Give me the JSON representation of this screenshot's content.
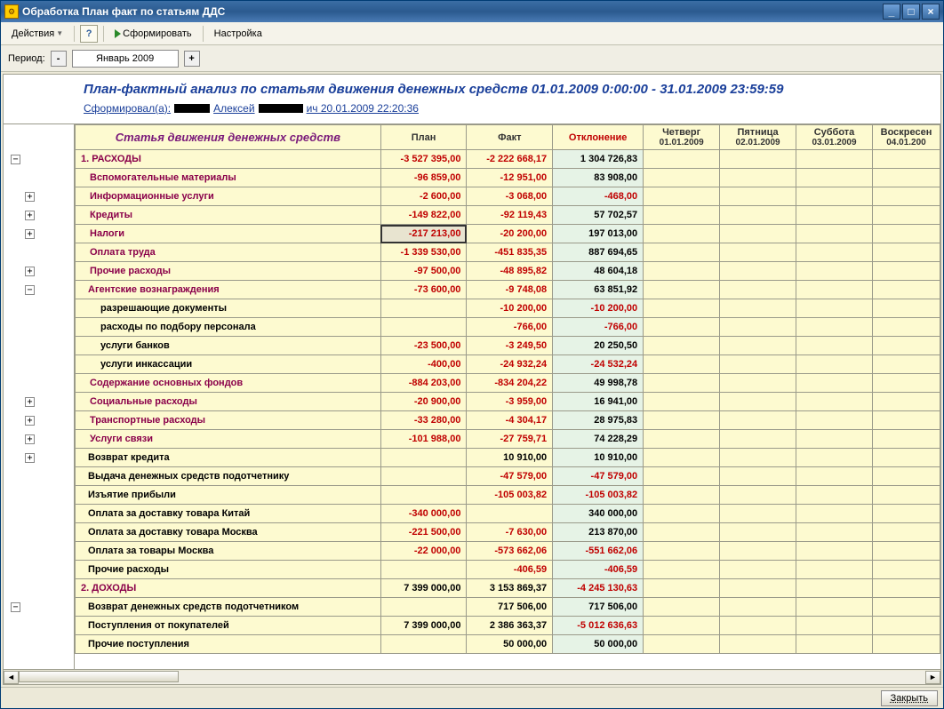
{
  "window": {
    "title": "Обработка  План факт по статьям ДДС"
  },
  "menubar": {
    "actions": "Действия",
    "help": "?",
    "form": "Сформировать",
    "settings": "Настройка"
  },
  "periodbar": {
    "label": "Период:",
    "value": "Январь 2009"
  },
  "report": {
    "title": "План-фактный анализ по статьям движения денежных средств  01.01.2009 0:00:00  -  31.01.2009 23:59:59",
    "formed_prefix": "Сформировал(а): ",
    "formed_name_mid": " Алексей ",
    "formed_name_suffix": "ич 20.01.2009 22:20:36"
  },
  "columns": {
    "article": "Статья движения денежных средств",
    "plan": "План",
    "fact": "Факт",
    "dev": "Отклонение",
    "d1_top": "Четверг",
    "d1_bot": "01.01.2009",
    "d2_top": "Пятница",
    "d2_bot": "02.01.2009",
    "d3_top": "Суббота",
    "d3_bot": "03.01.2009",
    "d4_top": "Воскресен",
    "d4_bot": "04.01.200"
  },
  "rows": [
    {
      "id": "r0",
      "cls": "section",
      "pad": 0,
      "article": "1. РАСХОДЫ",
      "plan": "-3 527 395,00",
      "fact": "-2 222 668,17",
      "dev": "1 304 726,83",
      "pneg": true,
      "fneg": true,
      "dneg": false
    },
    {
      "id": "r1",
      "cls": "cat",
      "pad": 1,
      "article": "Вспомогательные материалы",
      "plan": "-96 859,00",
      "fact": "-12 951,00",
      "dev": "83 908,00",
      "pneg": true,
      "fneg": true,
      "dneg": false
    },
    {
      "id": "r2",
      "cls": "cat",
      "pad": 1,
      "article": "Информационные услуги",
      "plan": "-2 600,00",
      "fact": "-3 068,00",
      "dev": "-468,00",
      "pneg": true,
      "fneg": true,
      "dneg": true
    },
    {
      "id": "r3",
      "cls": "cat",
      "pad": 1,
      "article": "Кредиты",
      "plan": "-149 822,00",
      "fact": "-92 119,43",
      "dev": "57 702,57",
      "pneg": true,
      "fneg": true,
      "dneg": false
    },
    {
      "id": "r4",
      "cls": "cat",
      "pad": 1,
      "article": "Налоги",
      "plan": "-217 213,00",
      "fact": "-20 200,00",
      "dev": "197 013,00",
      "pneg": true,
      "fneg": true,
      "dneg": false,
      "sel": true
    },
    {
      "id": "r5",
      "cls": "cat",
      "pad": 1,
      "article": "Оплата труда",
      "plan": "-1 339 530,00",
      "fact": "-451 835,35",
      "dev": "887 694,65",
      "pneg": true,
      "fneg": true,
      "dneg": false
    },
    {
      "id": "r6",
      "cls": "cat",
      "pad": 1,
      "article": "Прочие расходы",
      "plan": "-97 500,00",
      "fact": "-48 895,82",
      "dev": "48 604,18",
      "pneg": true,
      "fneg": true,
      "dneg": false
    },
    {
      "id": "r7",
      "cls": "subcat",
      "pad": 2,
      "article": "Агентские вознаграждения",
      "plan": "-73 600,00",
      "fact": "-9 748,08",
      "dev": "63 851,92",
      "pneg": true,
      "fneg": true,
      "dneg": false
    },
    {
      "id": "r8",
      "cls": "leaf",
      "pad": 2,
      "article": "разрешающие документы",
      "plan": "",
      "fact": "-10 200,00",
      "dev": "-10 200,00",
      "pneg": false,
      "fneg": true,
      "dneg": true
    },
    {
      "id": "r9",
      "cls": "leaf",
      "pad": 2,
      "article": "расходы по подбору персонала",
      "plan": "",
      "fact": "-766,00",
      "dev": "-766,00",
      "pneg": false,
      "fneg": true,
      "dneg": true
    },
    {
      "id": "r10",
      "cls": "leaf",
      "pad": 2,
      "article": "услуги банков",
      "plan": "-23 500,00",
      "fact": "-3 249,50",
      "dev": "20 250,50",
      "pneg": true,
      "fneg": true,
      "dneg": false
    },
    {
      "id": "r11",
      "cls": "leaf",
      "pad": 2,
      "article": "услуги инкассации",
      "plan": "-400,00",
      "fact": "-24 932,24",
      "dev": "-24 532,24",
      "pneg": true,
      "fneg": true,
      "dneg": true
    },
    {
      "id": "r12",
      "cls": "cat",
      "pad": 1,
      "article": "Содержание основных фондов",
      "plan": "-884 203,00",
      "fact": "-834 204,22",
      "dev": "49 998,78",
      "pneg": true,
      "fneg": true,
      "dneg": false
    },
    {
      "id": "r13",
      "cls": "cat",
      "pad": 1,
      "article": "Социальные расходы",
      "plan": "-20 900,00",
      "fact": "-3 959,00",
      "dev": "16 941,00",
      "pneg": true,
      "fneg": true,
      "dneg": false
    },
    {
      "id": "r14",
      "cls": "cat",
      "pad": 1,
      "article": "Транспортные расходы",
      "plan": "-33 280,00",
      "fact": "-4 304,17",
      "dev": "28 975,83",
      "pneg": true,
      "fneg": true,
      "dneg": false
    },
    {
      "id": "r15",
      "cls": "cat",
      "pad": 1,
      "article": "Услуги связи",
      "plan": "-101 988,00",
      "fact": "-27 759,71",
      "dev": "74 228,29",
      "pneg": true,
      "fneg": true,
      "dneg": false
    },
    {
      "id": "r16",
      "cls": "plain",
      "pad": 1,
      "article": "Возврат кредита",
      "plan": "",
      "fact": "10 910,00",
      "dev": "10 910,00",
      "pneg": false,
      "fneg": false,
      "dneg": false
    },
    {
      "id": "r17",
      "cls": "plain",
      "pad": 1,
      "article": "Выдача денежных средств подотчетнику",
      "plan": "",
      "fact": "-47 579,00",
      "dev": "-47 579,00",
      "pneg": false,
      "fneg": true,
      "dneg": true
    },
    {
      "id": "r18",
      "cls": "plain",
      "pad": 1,
      "article": "Изъятие прибыли",
      "plan": "",
      "fact": "-105 003,82",
      "dev": "-105 003,82",
      "pneg": false,
      "fneg": true,
      "dneg": true
    },
    {
      "id": "r19",
      "cls": "plain",
      "pad": 1,
      "article": "Оплата за доставку товара Китай",
      "plan": "-340 000,00",
      "fact": "",
      "dev": "340 000,00",
      "pneg": true,
      "fneg": false,
      "dneg": false
    },
    {
      "id": "r20",
      "cls": "plain",
      "pad": 1,
      "article": "Оплата за доставку товара Москва",
      "plan": "-221 500,00",
      "fact": "-7 630,00",
      "dev": "213 870,00",
      "pneg": true,
      "fneg": true,
      "dneg": false
    },
    {
      "id": "r21",
      "cls": "plain",
      "pad": 1,
      "article": "Оплата за товары Москва",
      "plan": "-22 000,00",
      "fact": "-573 662,06",
      "dev": "-551 662,06",
      "pneg": true,
      "fneg": true,
      "dneg": true
    },
    {
      "id": "r22",
      "cls": "plain",
      "pad": 1,
      "article": "Прочие расходы",
      "plan": "",
      "fact": "-406,59",
      "dev": "-406,59",
      "pneg": false,
      "fneg": true,
      "dneg": true
    },
    {
      "id": "r23",
      "cls": "section",
      "pad": 0,
      "article": "2. ДОХОДЫ",
      "plan": "7 399 000,00",
      "fact": "3 153 869,37",
      "dev": "-4 245 130,63",
      "pneg": false,
      "fneg": false,
      "dneg": true
    },
    {
      "id": "r24",
      "cls": "plain",
      "pad": 1,
      "article": "Возврат денежных средств подотчетником",
      "plan": "",
      "fact": "717 506,00",
      "dev": "717 506,00",
      "pneg": false,
      "fneg": false,
      "dneg": false
    },
    {
      "id": "r25",
      "cls": "plain",
      "pad": 1,
      "article": "Поступления от покупателей",
      "plan": "7 399 000,00",
      "fact": "2 386 363,37",
      "dev": "-5 012 636,63",
      "pneg": false,
      "fneg": false,
      "dneg": true
    },
    {
      "id": "r26",
      "cls": "plain",
      "pad": 1,
      "article": "Прочие поступления",
      "plan": "",
      "fact": "50 000,00",
      "dev": "50 000,00",
      "pneg": false,
      "fneg": false,
      "dneg": false
    }
  ],
  "tree": [
    {
      "sym": "−",
      "lvl": 0
    },
    {
      "sym": "",
      "lvl": 0
    },
    {
      "sym": "+",
      "lvl": 1
    },
    {
      "sym": "+",
      "lvl": 1
    },
    {
      "sym": "+",
      "lvl": 1
    },
    {
      "sym": "",
      "lvl": 1
    },
    {
      "sym": "+",
      "lvl": 1
    },
    {
      "sym": "−",
      "lvl": 1
    },
    {
      "sym": "",
      "lvl": 1
    },
    {
      "sym": "",
      "lvl": 1
    },
    {
      "sym": "",
      "lvl": 1
    },
    {
      "sym": "",
      "lvl": 1
    },
    {
      "sym": "",
      "lvl": 1
    },
    {
      "sym": "+",
      "lvl": 1
    },
    {
      "sym": "+",
      "lvl": 1
    },
    {
      "sym": "+",
      "lvl": 1
    },
    {
      "sym": "+",
      "lvl": 1
    },
    {
      "sym": "",
      "lvl": 1
    },
    {
      "sym": "",
      "lvl": 1
    },
    {
      "sym": "",
      "lvl": 1
    },
    {
      "sym": "",
      "lvl": 1
    },
    {
      "sym": "",
      "lvl": 1
    },
    {
      "sym": "",
      "lvl": 1
    },
    {
      "sym": "",
      "lvl": 1
    },
    {
      "sym": "−",
      "lvl": 0
    },
    {
      "sym": "",
      "lvl": 1
    },
    {
      "sym": "",
      "lvl": 1
    },
    {
      "sym": "",
      "lvl": 1
    }
  ],
  "footer": {
    "close": "Закрыть"
  }
}
